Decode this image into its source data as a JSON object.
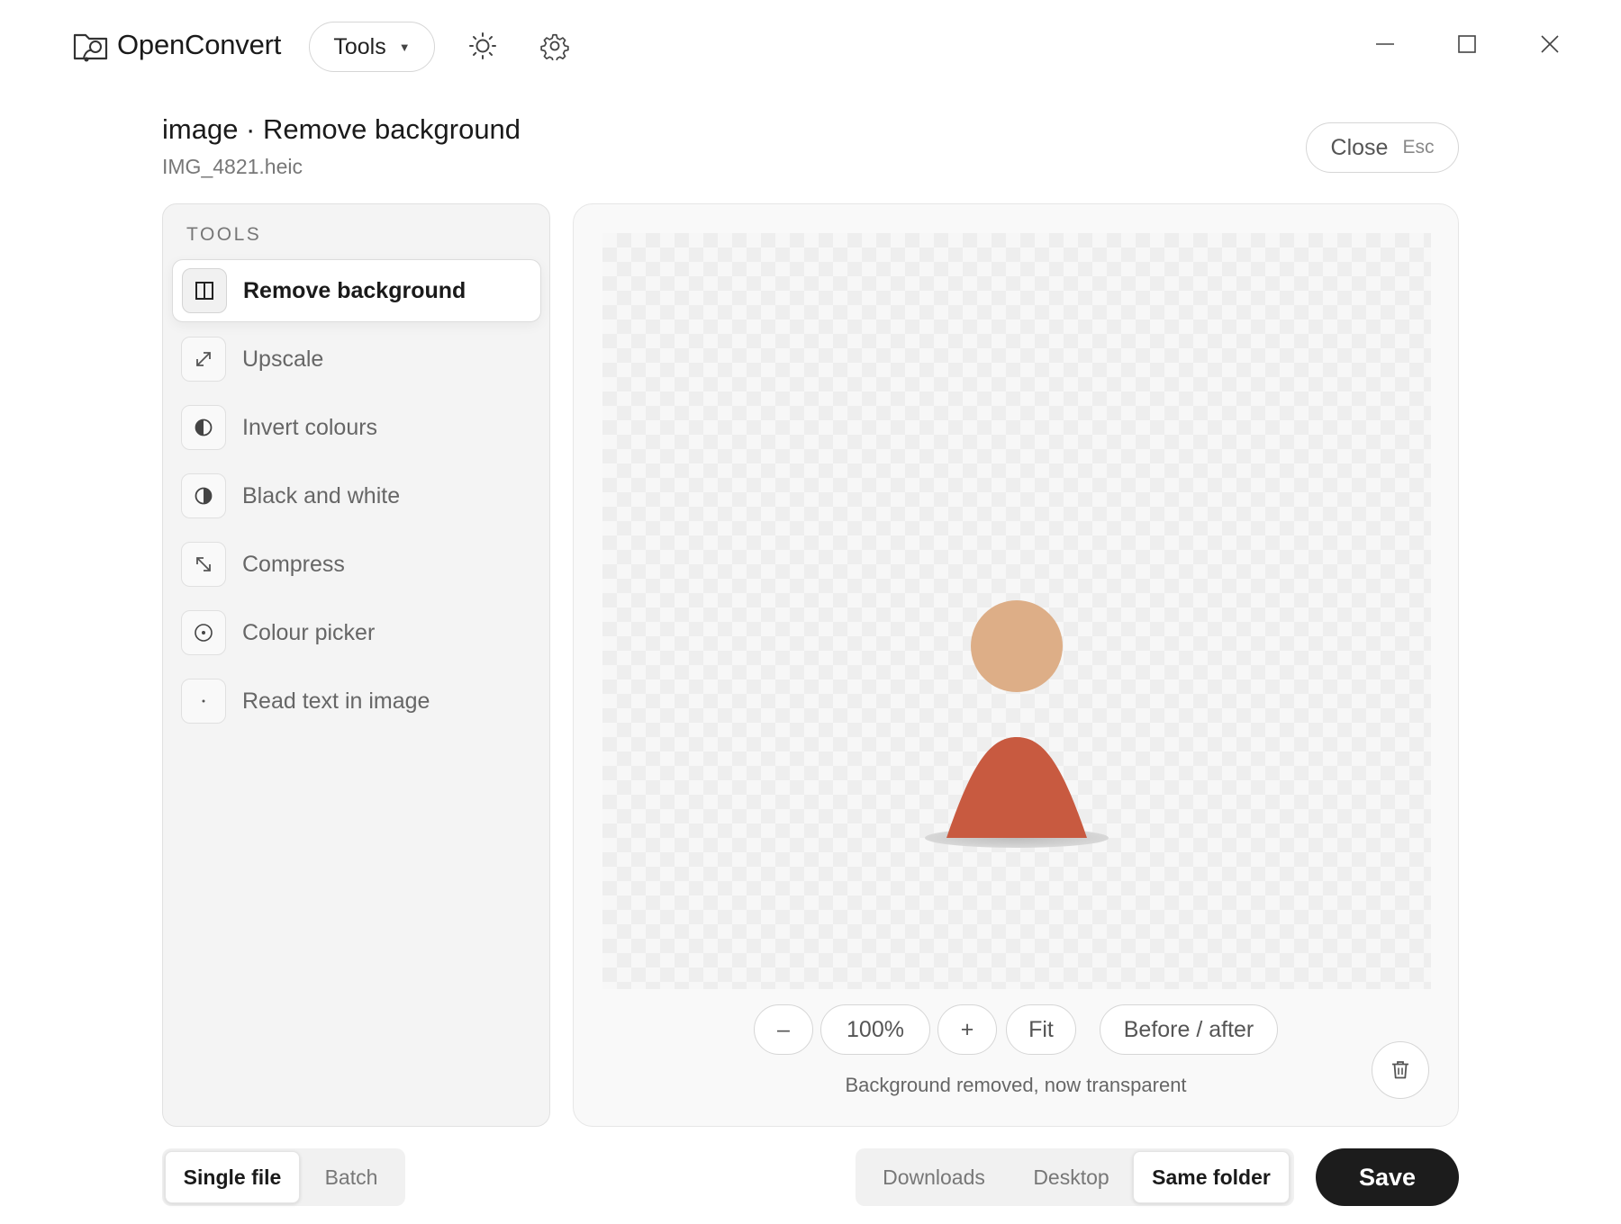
{
  "app": {
    "title": "OpenConvert",
    "tools_menu_label": "Tools",
    "theme_icon": "sun-icon",
    "settings_icon": "gear-icon"
  },
  "window_controls": [
    "minimize-icon",
    "maximize-icon",
    "close-icon"
  ],
  "header": {
    "title": "image · Remove background",
    "file_name": "IMG_4821.heic",
    "close_label": "Close",
    "close_shortcut": "Esc"
  },
  "tools_panel": {
    "heading": "TOOLS",
    "items": [
      {
        "label": "Remove background",
        "icon": "split-square-icon",
        "active": true
      },
      {
        "label": "Upscale",
        "icon": "expand-diagonal-icon",
        "active": false
      },
      {
        "label": "Invert colours",
        "icon": "half-circle-icon",
        "active": false
      },
      {
        "label": "Black and white",
        "icon": "contrast-icon",
        "active": false
      },
      {
        "label": "Compress",
        "icon": "compress-diagonal-icon",
        "active": false
      },
      {
        "label": "Colour picker",
        "icon": "target-dot-icon",
        "active": false
      },
      {
        "label": "Read text in image",
        "icon": "dot-icon",
        "active": false
      }
    ]
  },
  "preview": {
    "zoom_out_label": "–",
    "zoom_level": "100%",
    "zoom_in_label": "+",
    "fit_label": "Fit",
    "before_after_label": "Before / after",
    "status": "Background removed, now transparent",
    "colors": {
      "head": "#DDAE87",
      "body": "#C85A40",
      "shadow": "#c8c8c8"
    }
  },
  "footer": {
    "mode_options": [
      "Single file",
      "Batch"
    ],
    "mode_selected": 0,
    "destination_options": [
      "Downloads",
      "Desktop",
      "Same folder"
    ],
    "destination_selected": 2,
    "save_label": "Save"
  }
}
